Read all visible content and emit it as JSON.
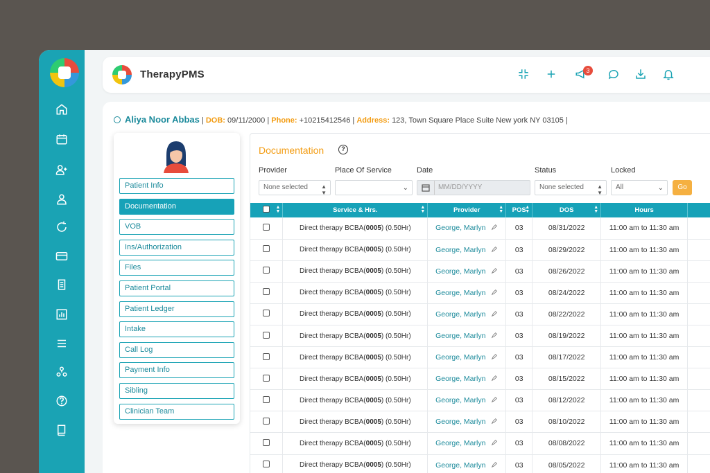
{
  "app": {
    "title": "TherapyPMS",
    "notification_count": "3"
  },
  "sidebar_icons": [
    "home-icon",
    "calendar-icon",
    "add-user-icon",
    "client-icon",
    "sync-icon",
    "billing-card-icon",
    "payroll-icon",
    "report-chart-icon",
    "list-icon",
    "team-icon",
    "help-icon",
    "book-icon"
  ],
  "topbar_icons": [
    "compress-icon",
    "plus-icon",
    "megaphone-icon",
    "chat-icon",
    "download-icon",
    "bell-icon"
  ],
  "patient": {
    "name": "Aliya Noor Abbas",
    "sep": "|",
    "dob_label": "DOB:",
    "dob": "09/11/2000",
    "phone_label": "Phone:",
    "phone": "+10215412546",
    "address_label": "Address:",
    "address": "123, Town Square Place Suite New york NY 03105"
  },
  "menu": [
    "Patient Info",
    "Documentation",
    "VOB",
    "Ins/Authorization",
    "Files",
    "Patient Portal",
    "Patient Ledger",
    "Intake",
    "Call Log",
    "Payment Info",
    "Sibling",
    "Clinician Team"
  ],
  "active_menu_index": 1,
  "documentation": {
    "title": "Documentation",
    "help": "?",
    "filters": {
      "provider_label": "Provider",
      "provider_value": "None selected",
      "pos_label": "Place Of Service",
      "pos_value": "",
      "date_label": "Date",
      "date_placeholder": "MM/DD/YYYY",
      "status_label": "Status",
      "status_value": "None selected",
      "locked_label": "Locked",
      "locked_value": "All",
      "go_label": "Go"
    },
    "columns": [
      "Service & Hrs.",
      "Provider",
      "POS",
      "DOS",
      "Hours"
    ],
    "rows": [
      {
        "service_pre": "Direct therapy BCBA(",
        "service_code": "0005",
        "service_post": ") (0.50Hr)",
        "provider": "George, Marlyn",
        "pos": "03",
        "dos": "08/31/2022",
        "hours": "11:00 am to 11:30 am"
      },
      {
        "service_pre": "Direct therapy BCBA(",
        "service_code": "0005",
        "service_post": ") (0.50Hr)",
        "provider": "George, Marlyn",
        "pos": "03",
        "dos": "08/29/2022",
        "hours": "11:00 am to 11:30 am"
      },
      {
        "service_pre": "Direct therapy BCBA(",
        "service_code": "0005",
        "service_post": ") (0.50Hr)",
        "provider": "George, Marlyn",
        "pos": "03",
        "dos": "08/26/2022",
        "hours": "11:00 am to 11:30 am"
      },
      {
        "service_pre": "Direct therapy BCBA(",
        "service_code": "0005",
        "service_post": ") (0.50Hr)",
        "provider": "George, Marlyn",
        "pos": "03",
        "dos": "08/24/2022",
        "hours": "11:00 am to 11:30 am"
      },
      {
        "service_pre": "Direct therapy BCBA(",
        "service_code": "0005",
        "service_post": ") (0.50Hr)",
        "provider": "George, Marlyn",
        "pos": "03",
        "dos": "08/22/2022",
        "hours": "11:00 am to 11:30 am"
      },
      {
        "service_pre": "Direct therapy BCBA(",
        "service_code": "0005",
        "service_post": ") (0.50Hr)",
        "provider": "George, Marlyn",
        "pos": "03",
        "dos": "08/19/2022",
        "hours": "11:00 am to 11:30 am"
      },
      {
        "service_pre": "Direct therapy BCBA(",
        "service_code": "0005",
        "service_post": ") (0.50Hr)",
        "provider": "George, Marlyn",
        "pos": "03",
        "dos": "08/17/2022",
        "hours": "11:00 am to 11:30 am"
      },
      {
        "service_pre": "Direct therapy BCBA(",
        "service_code": "0005",
        "service_post": ") (0.50Hr)",
        "provider": "George, Marlyn",
        "pos": "03",
        "dos": "08/15/2022",
        "hours": "11:00 am to 11:30 am"
      },
      {
        "service_pre": "Direct therapy BCBA(",
        "service_code": "0005",
        "service_post": ") (0.50Hr)",
        "provider": "George, Marlyn",
        "pos": "03",
        "dos": "08/12/2022",
        "hours": "11:00 am to 11:30 am"
      },
      {
        "service_pre": "Direct therapy BCBA(",
        "service_code": "0005",
        "service_post": ") (0.50Hr)",
        "provider": "George, Marlyn",
        "pos": "03",
        "dos": "08/10/2022",
        "hours": "11:00 am to 11:30 am"
      },
      {
        "service_pre": "Direct therapy BCBA(",
        "service_code": "0005",
        "service_post": ") (0.50Hr)",
        "provider": "George, Marlyn",
        "pos": "03",
        "dos": "08/08/2022",
        "hours": "11:00 am to 11:30 am"
      },
      {
        "service_pre": "Direct therapy BCBA(",
        "service_code": "0005",
        "service_post": ") (0.50Hr)",
        "provider": "George, Marlyn",
        "pos": "03",
        "dos": "08/05/2022",
        "hours": "11:00 am to 11:30 am"
      }
    ]
  },
  "colors": {
    "primary": "#1aa3b4",
    "accent": "#f39c12",
    "go": "#f5b041"
  }
}
